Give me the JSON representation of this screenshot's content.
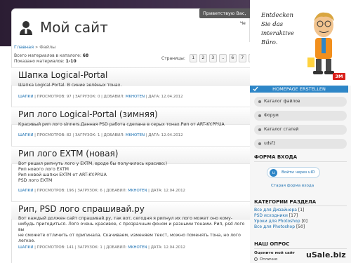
{
  "header": {
    "site_title": "Мой сайт",
    "welcome_tab": "Приветствую Вас, ",
    "right_stub": "Че"
  },
  "breadcrumb": {
    "home": "Главная",
    "separator": " » ",
    "current": "Файлы"
  },
  "stats": {
    "line1_label": "Всего материалов в каталоге: ",
    "line1_value": "68",
    "line2_label": "Показано материалов: ",
    "line2_value": "1-10"
  },
  "pager": {
    "label": "Страницы:",
    "pages": [
      "1",
      "2",
      "3",
      "..",
      "6",
      "7",
      "»"
    ]
  },
  "articles": [
    {
      "title": "Шапка Logical-Portal",
      "body": "Шапка Logical-Portal. В синие зелёных тонах.",
      "category": "ШАПКИ",
      "views": " | ПРОСМОТРОВ: 97 | ЗАГРУЗОК: 0 | ДОБАВИЛ: ",
      "author": "MKHOTEN",
      "date": " | ДАТА: 12.04.2012"
    },
    {
      "title": "Рип лого Logical-Portal (зимняя)",
      "body": "Красивый рип лого sinners.Данная PSD работа сделана в серых тонах.Рип от ART-KY.PP.UA",
      "category": "ШАПКИ",
      "views": " | ПРОСМОТРОВ: 82 | ЗАГРУЗОК: 1 | ДОБАВИЛ: ",
      "author": "MKHOTEN",
      "date": " | ДАТА: 12.04.2012"
    },
    {
      "title": "Рип лого EXTM (новая)",
      "body_lines": [
        "Вот решил рипнуть лого у EXTM, вроде бы получилось красиво:)",
        "Рип нового лого EXTM",
        "Рип новой шапки EXTM от ART-KY.PP.UA",
        "PSD лого EXTM"
      ],
      "category": "ШАПКИ",
      "views": " | ПРОСМОТРОВ: 196 | ЗАГРУЗОК: 6 | ДОБАВИЛ: ",
      "author": "MKHOTEN",
      "date": " | ДАТА: 12.04.2012"
    },
    {
      "title": "Рип, PSD лого спрашивай.ру",
      "body_lines": [
        " Вот каждый должен сайт спрашивай.ру, так вот, сегодня я рипнул их лого может оно кому-",
        "нибудь пригодиться. Лого очень красивое, с прозрачным фоном и разными тонами. Рип, psd лого вы",
        "не сможете отличить от оригинала. Скачиваем, изменяем текст, можно поменять тона, но лого",
        "легкое."
      ],
      "category": "ШАПКИ",
      "views": " | ПРОСМОТРОВ: 141 | ЗАГРУЗОК: 1 | ДОБАВИЛ: ",
      "author": "MKHOTEN",
      "date": " | ДАТА: 12.04.2012"
    }
  ],
  "ad": {
    "lines": [
      "Entdecken",
      "Sie das",
      "interaktive",
      "Büro."
    ],
    "brand": "3M"
  },
  "sidebar": {
    "homepage_button": "HOMEPAGE ERSTELLEN",
    "menu": [
      "Каталог файлов",
      "Форум",
      "Каталог статей",
      "udsf}"
    ],
    "login_title": "ФОРМА ВХОДА",
    "login_button": "Войти через uID",
    "login_icon": "u",
    "old_login": "Старая форма входа",
    "categories_title": "КАТЕГОРИИ РАЗДЕЛА",
    "categories": [
      {
        "name": "Все для Дизайнера",
        "count": " [1]"
      },
      {
        "name": "PSD исходники",
        "count": " [17]"
      },
      {
        "name": "Уроки для Photoshop",
        "count": " [0]"
      },
      {
        "name": "Все для Photoshop",
        "count": " [50]"
      }
    ],
    "poll_title": "НАШ ОПРОС",
    "poll_question": "Оцените мой сайт",
    "poll_option": "Отлично"
  },
  "watermark": "uSale.biz",
  "colors": {
    "accent": "#1a6fb0",
    "homepage_bar": "#2e86c7",
    "brand_red": "#d9211c"
  }
}
